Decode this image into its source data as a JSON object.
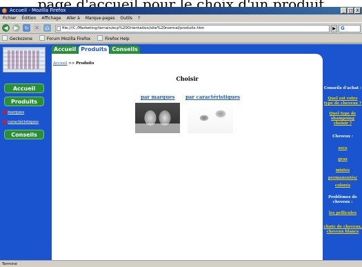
{
  "caption": "page d'accueil pour le choix d'un produit",
  "window": {
    "title": "Accueil - Mozilla Firefox",
    "controls": [
      "_",
      "□",
      "X"
    ]
  },
  "menu": [
    "Fichier",
    "Édition",
    "Affichage",
    "Aller à",
    "Marque-pages",
    "Outils",
    "?"
  ],
  "toolbar": {
    "url": "file:///C:/Marketing/terrain/ecp%20Orientation/site%20normal/produits.htm",
    "go": "▶",
    "search": "G"
  },
  "bookmarks": [
    "Geckozone",
    "Forum Mozilla Firefox",
    "Firefox Help"
  ],
  "left_nav": {
    "buttons": [
      "Accueil",
      "Produits",
      "Conseils"
    ],
    "links": [
      "marques",
      "caractéristiques"
    ]
  },
  "tabs": [
    {
      "label": "Accueil",
      "active": false
    },
    {
      "label": "Produits",
      "active": true
    },
    {
      "label": "Conseils",
      "active": false
    }
  ],
  "breadcrumb": {
    "home": "Accueil",
    "sep": " >> ",
    "current": "Produits"
  },
  "main": {
    "title": "Choisir",
    "choices": [
      "par marques",
      "par caractéristiques"
    ]
  },
  "right_nav": {
    "heading": "Conseils d'achat :",
    "advice_links": [
      "Quel est votre type de cheveux ?",
      "Quel type de shampoing choisir ?"
    ],
    "hair_heading": "Cheveux :",
    "hair_links": [
      "secs",
      "gras",
      "mixtes",
      "permanentés/",
      "colorés"
    ],
    "problems_heading": "Problèmes de cheveux :",
    "problem_links": [
      "les pellicules",
      "chute de cheveux, cheveux blancs"
    ]
  },
  "status": "Terminé"
}
